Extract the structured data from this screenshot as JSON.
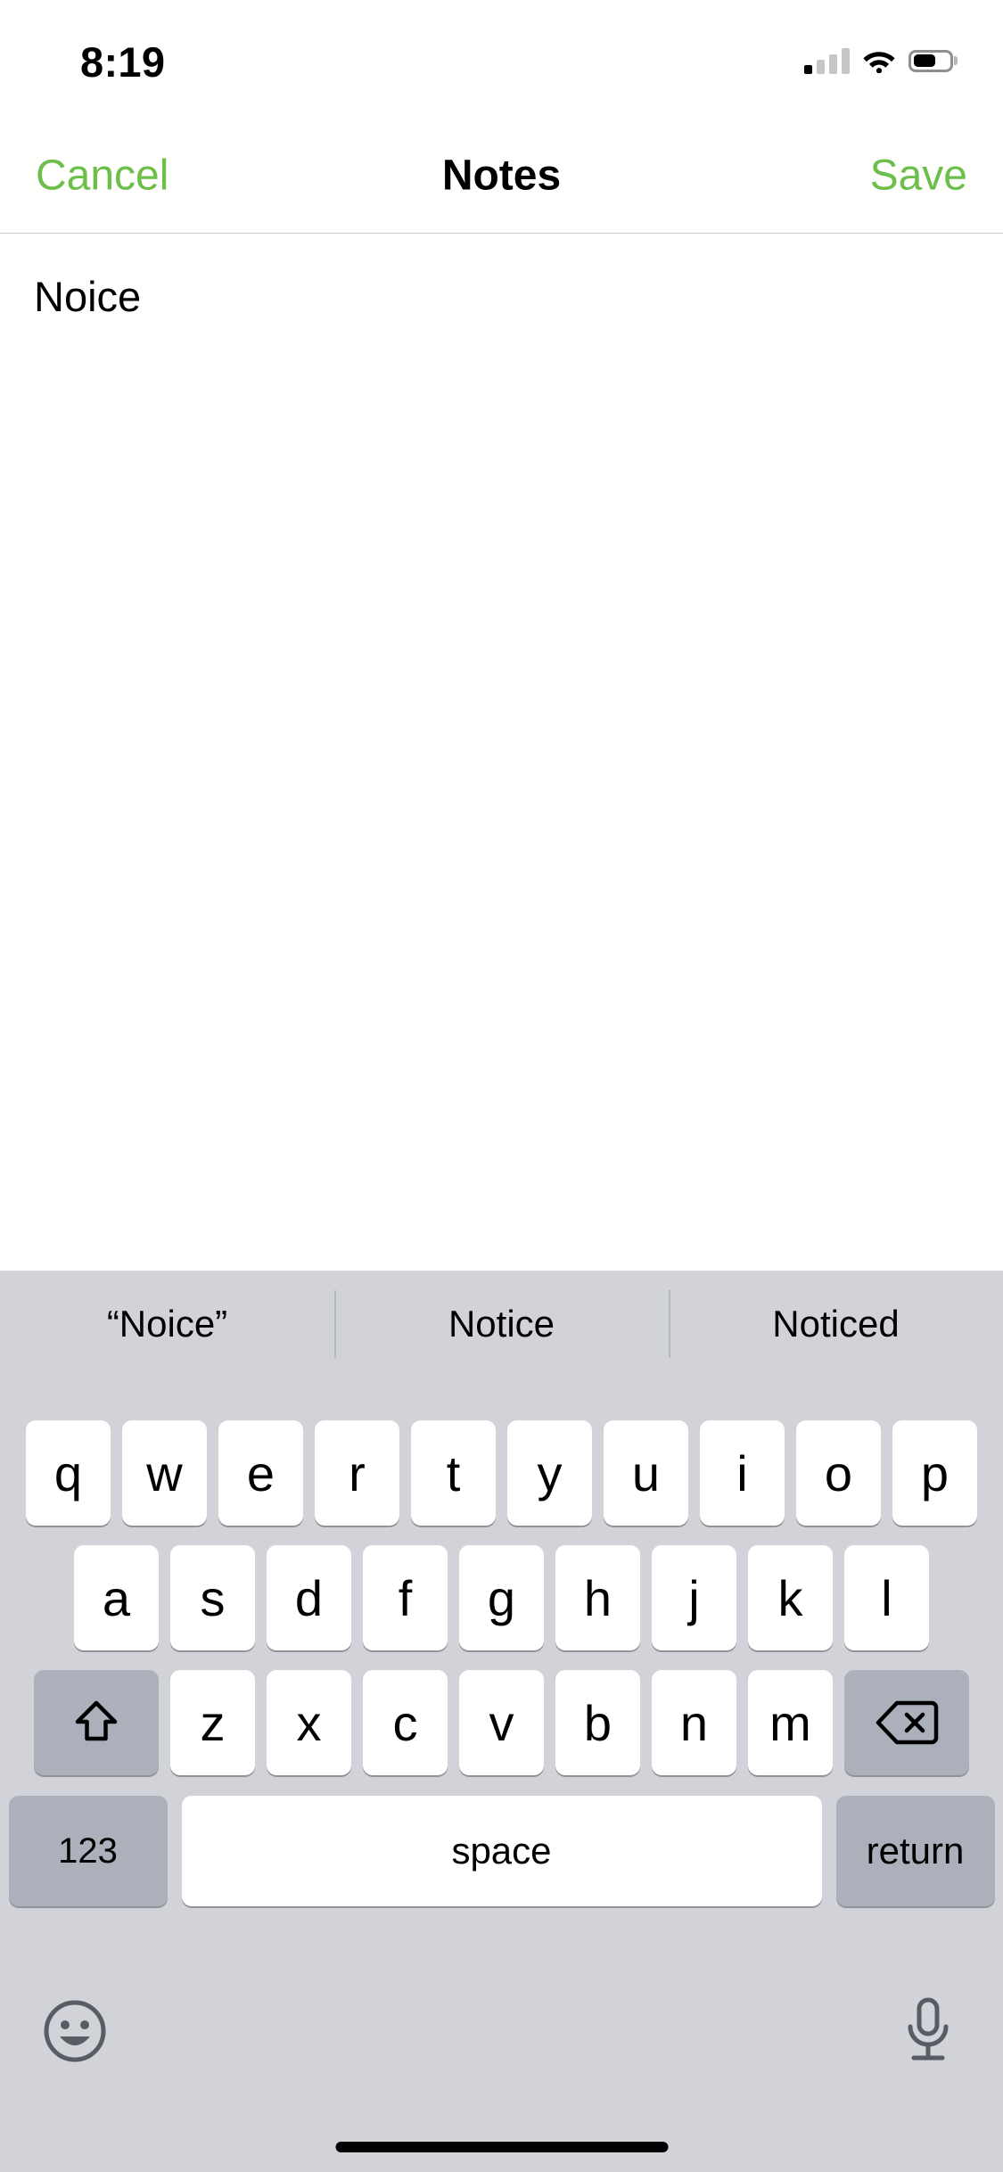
{
  "status_bar": {
    "time": "8:19",
    "cellular_icon": "cellular-signal-icon",
    "cellular_bars_active": 1,
    "cellular_bars_total": 4,
    "wifi_icon": "wifi-icon",
    "battery_icon": "battery-icon",
    "battery_percent": 55
  },
  "nav_bar": {
    "cancel_label": "Cancel",
    "title": "Notes",
    "save_label": "Save",
    "accent_color": "#6CBF4B"
  },
  "note": {
    "text": "Noice",
    "placeholder": ""
  },
  "keyboard": {
    "background_color": "#D1D3D9",
    "predictions": [
      "“Noice”",
      "Notice",
      "Noticed"
    ],
    "row1": [
      "q",
      "w",
      "e",
      "r",
      "t",
      "y",
      "u",
      "i",
      "o",
      "p"
    ],
    "row2": [
      "a",
      "s",
      "d",
      "f",
      "g",
      "h",
      "j",
      "k",
      "l"
    ],
    "row3": [
      "z",
      "x",
      "c",
      "v",
      "b",
      "n",
      "m"
    ],
    "shift_icon": "shift-icon",
    "backspace_icon": "backspace-icon",
    "numbers_label": "123",
    "space_label": "space",
    "return_label": "return",
    "emoji_icon": "emoji-smiley-icon",
    "dictation_icon": "microphone-icon"
  },
  "home_indicator": "home-indicator"
}
